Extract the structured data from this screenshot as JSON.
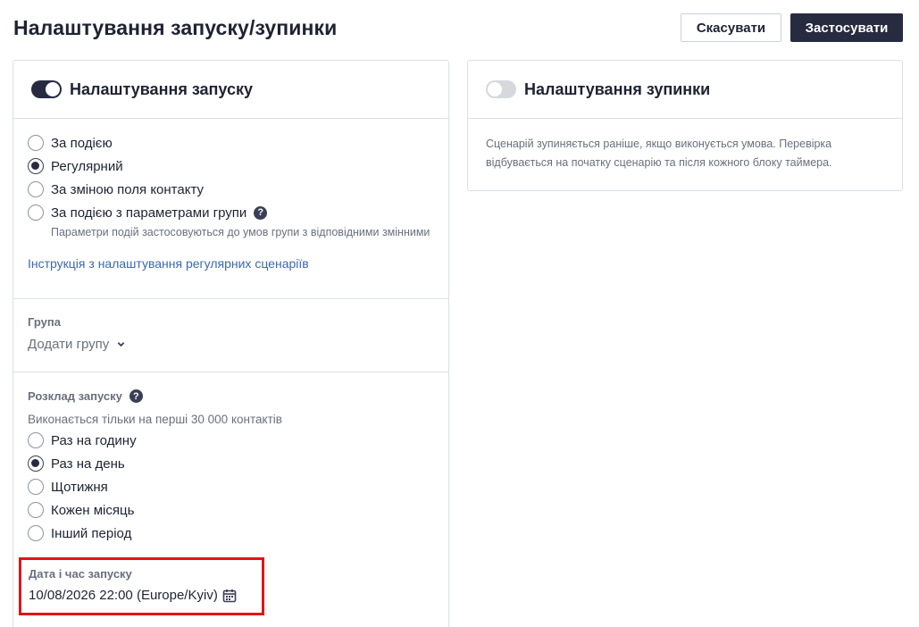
{
  "header": {
    "title": "Налаштування запуску/зупинки",
    "cancel_label": "Скасувати",
    "apply_label": "Застосувати"
  },
  "launch": {
    "title": "Налаштування запуску",
    "enabled": true,
    "trigger_options": [
      {
        "label": "За подією",
        "checked": false
      },
      {
        "label": "Регулярний",
        "checked": true
      },
      {
        "label": "За зміною поля контакту",
        "checked": false
      },
      {
        "label": "За подією з параметрами групи",
        "checked": false
      }
    ],
    "group_params_note": "Параметри подій застосовуються до умов групи з відповідними змінними",
    "instruction_link": "Інструкція з налаштування регулярних сценаріїв",
    "group": {
      "label": "Група",
      "placeholder": "Додати групу"
    },
    "schedule": {
      "label": "Розклад запуску",
      "note": "Виконається тільки на перші 30 000 контактів",
      "options": [
        {
          "label": "Раз на годину",
          "checked": false
        },
        {
          "label": "Раз на день",
          "checked": true
        },
        {
          "label": "Щотижня",
          "checked": false
        },
        {
          "label": "Кожен місяць",
          "checked": false
        },
        {
          "label": "Інший період",
          "checked": false
        }
      ]
    },
    "datetime": {
      "label": "Дата і час запуску",
      "value": "10/08/2026 22:00 (Europe/Kyiv)"
    }
  },
  "stop": {
    "title": "Налаштування зупинки",
    "enabled": false,
    "description": "Сценарій зупиняється раніше, якщо виконується умова. Перевірка відбувається на початку сценарію та після кожного блоку таймера."
  },
  "colors": {
    "primary": "#262b40",
    "link": "#3a69b0",
    "highlight": "#e01515"
  }
}
